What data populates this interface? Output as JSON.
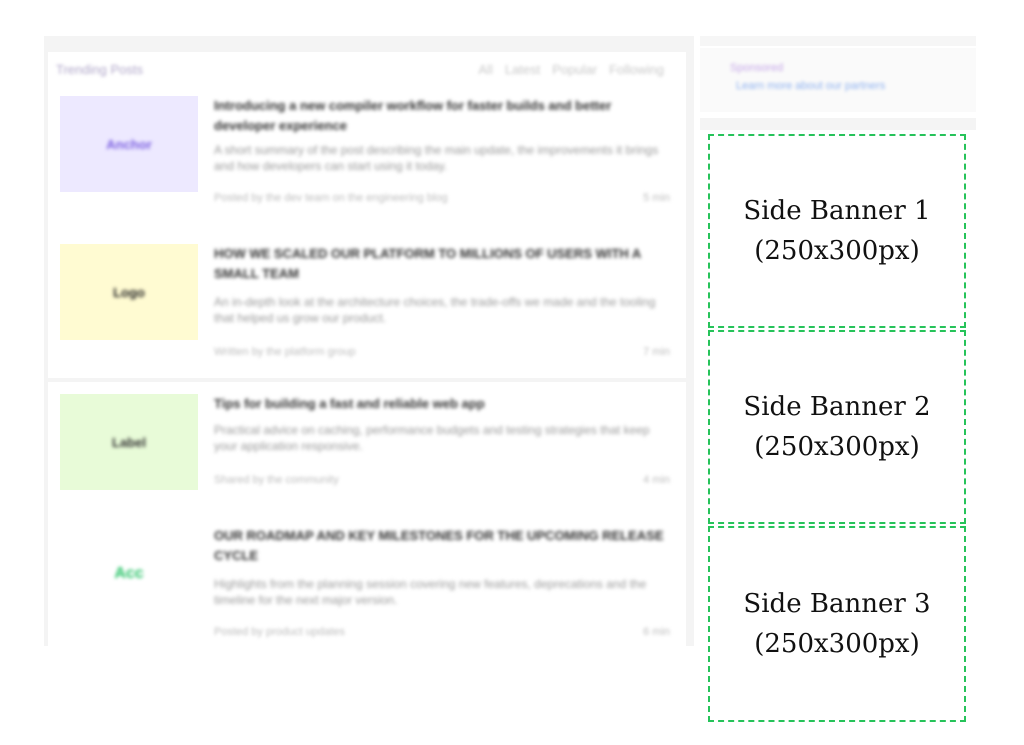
{
  "section": {
    "title": "Trending Posts",
    "tabs": [
      "All",
      "Latest",
      "Popular",
      "Following"
    ]
  },
  "articles": [
    {
      "thumb_text": "Anchor",
      "thumb_bg": "#ede9ff",
      "thumb_fg": "#7a5ee0",
      "title": "Introducing a new compiler workflow for faster builds and better developer experience",
      "excerpt": "A short summary of the post describing the main update, the improvements it brings and how developers can start using it today.",
      "meta": "Posted by the dev team on the engineering blog",
      "read": "5 min"
    },
    {
      "thumb_text": "Logo",
      "thumb_bg": "#fffbd2",
      "thumb_fg": "#222222",
      "title": "HOW WE SCALED OUR PLATFORM TO MILLIONS OF USERS WITH A SMALL TEAM",
      "excerpt": "An in-depth look at the architecture choices, the trade-offs we made and the tooling that helped us grow our product.",
      "meta": "Written by the platform group",
      "read": "7 min"
    },
    {
      "thumb_text": "Label",
      "thumb_bg": "#e8fbd8",
      "thumb_fg": "#333333",
      "title": "Tips for building a fast and reliable web app",
      "excerpt": "Practical advice on caching, performance budgets and testing strategies that keep your application responsive.",
      "meta": "Shared by the community",
      "read": "4 min"
    },
    {
      "thumb_text": "Acc",
      "thumb_bg": "#ffffff",
      "thumb_fg": "#27c266",
      "title": "OUR ROADMAP AND KEY MILESTONES FOR THE UPCOMING RELEASE CYCLE",
      "excerpt": "Highlights from the planning session covering new features, deprecations and the timeline for the next major version.",
      "meta": "Posted by product updates",
      "read": "6 min"
    }
  ],
  "side_top": {
    "line1": "Sponsored",
    "line2": "Learn more about our partners"
  },
  "banners": [
    {
      "label": "Side Banner 1",
      "size": "(250x300px)"
    },
    {
      "label": "Side Banner 2",
      "size": "(250x300px)"
    },
    {
      "label": "Side Banner 3",
      "size": "(250x300px)"
    }
  ],
  "colors": {
    "banner_border": "#26c35a",
    "main_bg": "#f4f4f4"
  }
}
